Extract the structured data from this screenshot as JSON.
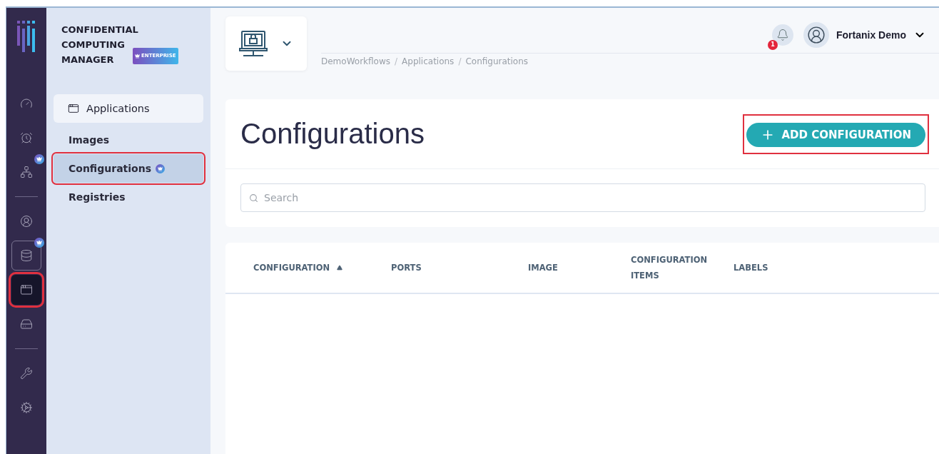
{
  "rail": {
    "groups": [
      [
        {
          "selected": false,
          "focused": false,
          "badge": false,
          "highlighted": false
        },
        {
          "selected": false,
          "focused": false,
          "badge": false,
          "highlighted": false
        },
        {
          "selected": false,
          "focused": false,
          "badge": true,
          "highlighted": false
        }
      ],
      [
        {
          "selected": false,
          "focused": false,
          "badge": false,
          "highlighted": false
        },
        {
          "selected": false,
          "focused": true,
          "badge": true,
          "highlighted": false
        },
        {
          "selected": true,
          "focused": false,
          "badge": false,
          "highlighted": true
        },
        {
          "selected": false,
          "focused": false,
          "badge": false,
          "highlighted": false
        }
      ],
      [
        {
          "selected": false,
          "focused": false,
          "badge": false,
          "highlighted": false
        },
        {
          "selected": false,
          "focused": false,
          "badge": false,
          "highlighted": false
        }
      ]
    ]
  },
  "sidebar": {
    "brand": {
      "title": "CONFIDENTIAL COMPUTING MANAGER",
      "badge": "ENTERPRISE"
    },
    "nav": {
      "label": "Applications",
      "children": [
        {
          "label": "Images",
          "selected": false,
          "premium": false,
          "highlighted": false
        },
        {
          "label": "Configurations",
          "selected": true,
          "premium": true,
          "highlighted": true
        },
        {
          "label": "Registries",
          "selected": false,
          "premium": false,
          "highlighted": false
        }
      ]
    }
  },
  "header": {
    "breadcrumb": [
      {
        "kind": "link",
        "text": "DemoWorkflows"
      },
      {
        "kind": "separator",
        "text": "/"
      },
      {
        "kind": "link",
        "text": "Applications"
      },
      {
        "kind": "separator",
        "text": "/"
      },
      {
        "kind": "link",
        "text": "Configurations"
      }
    ],
    "notifications": {
      "count": "1"
    },
    "user": {
      "name": "Fortanix Demo"
    }
  },
  "page": {
    "title": "Configurations",
    "add_button": {
      "label": "ADD CONFIGURATION",
      "highlighted": true
    },
    "search": {
      "placeholder": "Search"
    }
  },
  "table": {
    "columns": [
      {
        "label": "CONFIGURATION",
        "sorted": true
      },
      {
        "label": "PORTS",
        "sorted": false
      },
      {
        "label": "IMAGE",
        "sorted": false
      },
      {
        "label": "CONFIGURATION ITEMS",
        "sorted": false
      },
      {
        "label": "LABELS",
        "sorted": false
      }
    ]
  }
}
